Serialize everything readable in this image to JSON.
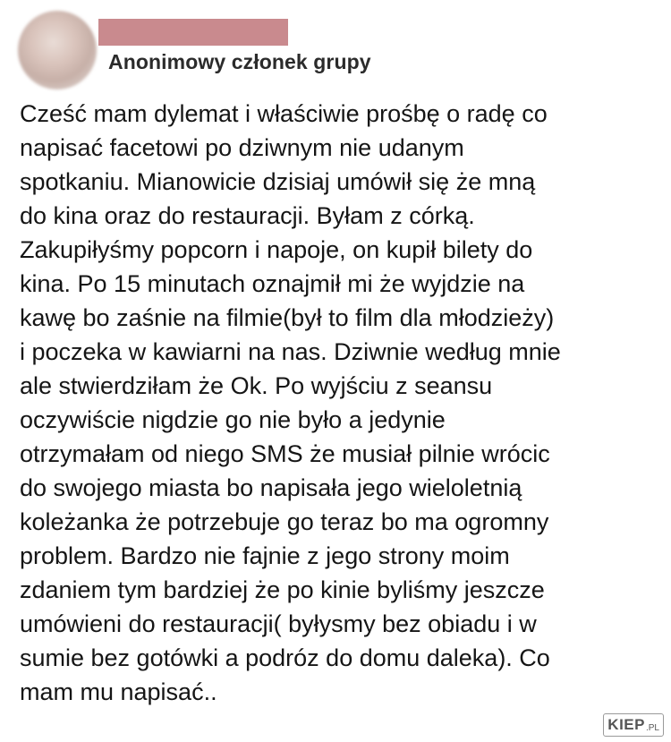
{
  "post": {
    "author": "Anonimowy członek grupy",
    "body_lines": [
      "Cześć mam dylemat i właściwie prośbę o radę co",
      "napisać facetowi po dziwnym nie udanym",
      "spotkaniu. Mianowicie dzisiaj umówił się że mną",
      "do kina oraz do restauracji. Byłam z córką.",
      "Zakupiłyśmy popcorn i napoje, on kupił bilety do",
      "kina. Po 15 minutach oznajmił mi że wyjdzie na",
      "kawę bo zaśnie na filmie(był to film dla młodzieży)",
      "i poczeka w kawiarni na nas. Dziwnie według mnie",
      "ale stwierdziłam że Ok. Po wyjściu z seansu",
      "oczywiście nigdzie go nie było a jedynie",
      "otrzymałam od niego SMS że musiał pilnie wrócic",
      "do swojego miasta bo napisała jego wieloletnią",
      "koleżanka że potrzebuje go teraz bo ma ogromny",
      "problem. Bardzo nie fajnie z jego strony moim",
      "zdaniem tym bardziej że po kinie byliśmy jeszcze",
      "umówieni do restauracji( byłysmy bez obiadu i w",
      "sumie bez gotówki a podróz do domu daleka). Co",
      "mam mu napisać.."
    ]
  },
  "watermark": {
    "main": "KIEP",
    "suffix": ".PL"
  },
  "colors": {
    "redaction": "#c98a8e",
    "text": "#151515"
  }
}
